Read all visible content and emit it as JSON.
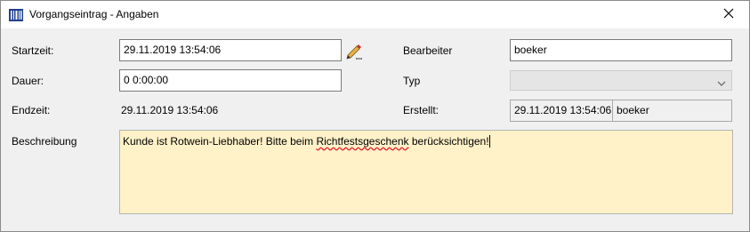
{
  "window": {
    "title": "Vorgangseintrag - Angaben",
    "icon": "barcode-app-icon",
    "close_icon": "close-icon"
  },
  "form": {
    "startzeit_label": "Startzeit:",
    "startzeit_value": "29.11.2019 13:54:06",
    "edit_icon": "pencil-edit-icon",
    "dauer_label": "Dauer:",
    "dauer_value": "0 0:00:00",
    "endzeit_label": "Endzeit:",
    "endzeit_value": "29.11.2019 13:54:06",
    "beschreibung_label": "Beschreibung",
    "bearbeiter_label": "Bearbeiter",
    "bearbeiter_value": "boeker",
    "typ_label": "Typ",
    "typ_value": "",
    "erstellt_label": "Erstellt:",
    "erstellt_date": "29.11.2019 13:54:06",
    "erstellt_user": "boeker",
    "description": {
      "before": "Kunde ist Rotwein-Liebhaber! Bitte beim ",
      "misspelled": "Richtfestsgeschenk",
      "after": " berücksichtigen!"
    }
  },
  "colors": {
    "description_bg": "#fff1c8",
    "window_bg": "#f0f0f0",
    "spellcheck_underline": "#e81123"
  }
}
